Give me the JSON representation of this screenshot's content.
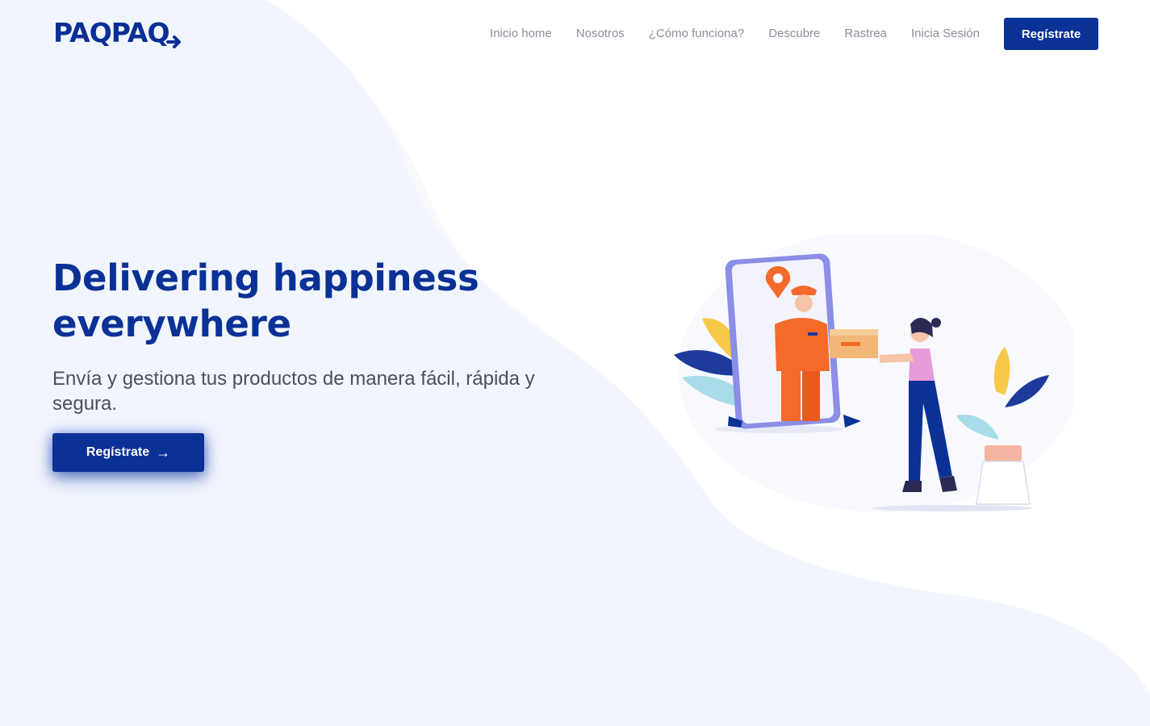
{
  "brand": {
    "logo_text": "PAQPAQ"
  },
  "nav": {
    "items": [
      {
        "label": "Inicio home"
      },
      {
        "label": "Nosotros"
      },
      {
        "label": "¿Cómo funciona?"
      },
      {
        "label": "Descubre"
      },
      {
        "label": "Rastrea"
      },
      {
        "label": "Inicia Sesión"
      }
    ],
    "cta_label": "Regístrate"
  },
  "hero": {
    "title_line1": "Delivering happiness",
    "title_line2": "everywhere",
    "subtitle": "Envía y gestiona tus productos de manera fácil, rápida y segura.",
    "cta_label": "Regístrate",
    "cta_icon": "arrow-right-icon"
  },
  "colors": {
    "brand_blue": "#0a3196",
    "accent_orange": "#f46a2a",
    "background": "#f1f5fd",
    "nav_text": "#8a8f99"
  }
}
